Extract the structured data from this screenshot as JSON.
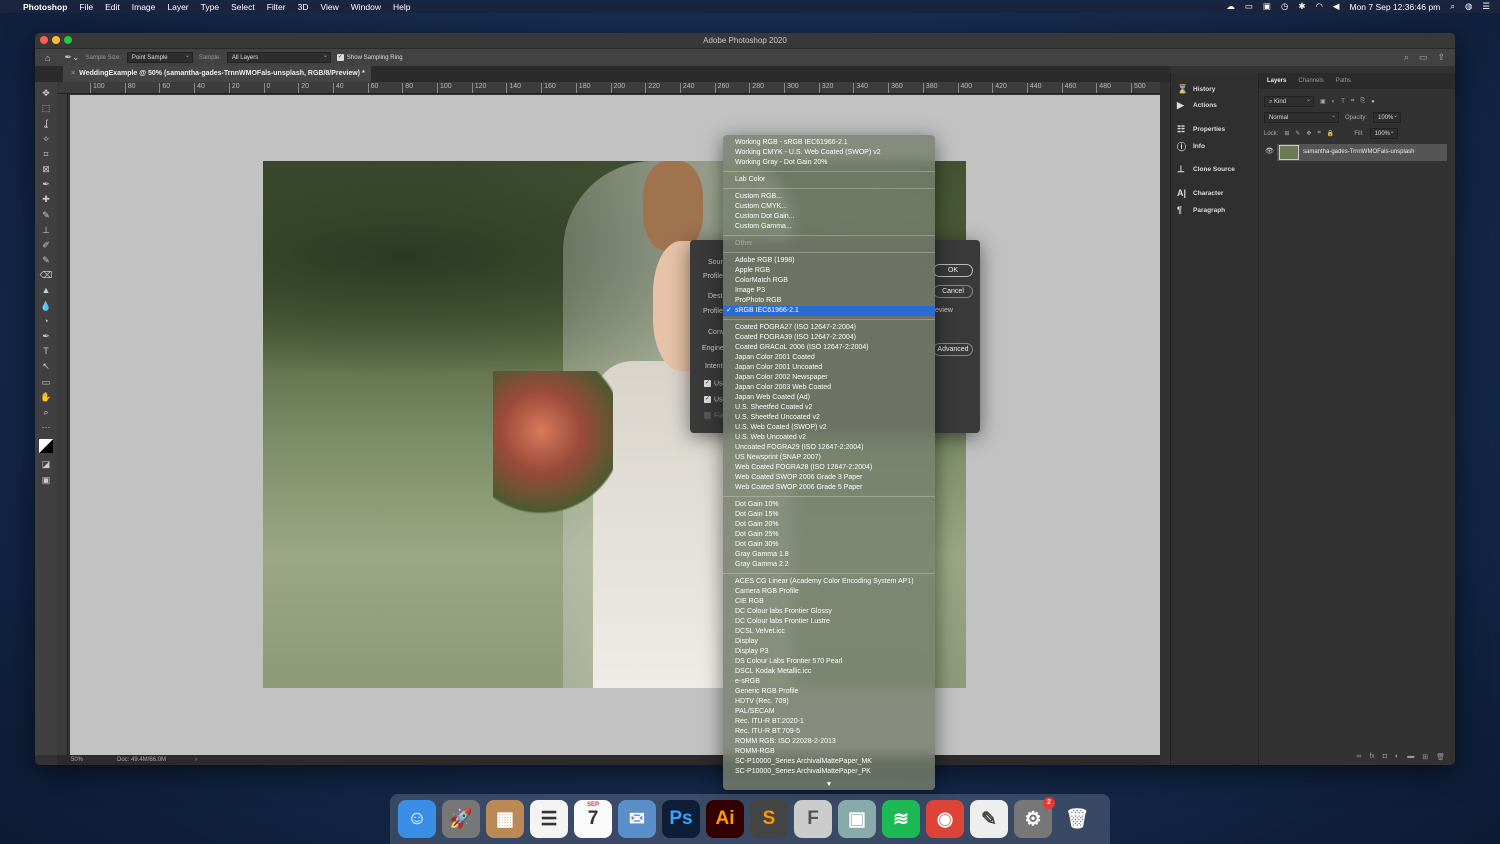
{
  "menubar": {
    "apple": "",
    "app": "Photoshop",
    "items": [
      "File",
      "Edit",
      "Image",
      "Layer",
      "Type",
      "Select",
      "Filter",
      "3D",
      "View",
      "Window",
      "Help"
    ],
    "clock": "Mon 7 Sep  12:36:46 pm"
  },
  "window": {
    "title": "Adobe Photoshop 2020"
  },
  "options": {
    "sample_size_label": "Sample Size:",
    "sample_size": "Point Sample",
    "sample_label": "Sample:",
    "sample": "All Layers",
    "show_ring": "Show Sampling Ring",
    "show_ring_checked": true
  },
  "document": {
    "tab": "WeddingExample @ 50% (samantha-gades-TrnnWMOFals-unsplash, RGB/8/Preview) *",
    "zoom": "50%",
    "doc_size": "Doc: 49.4M/66.0M"
  },
  "ruler": {
    "top": [
      "100",
      "80",
      "60",
      "40",
      "20",
      "0",
      "20",
      "40",
      "60",
      "80",
      "100",
      "120",
      "140",
      "160",
      "180",
      "200",
      "220",
      "240",
      "260",
      "280",
      "300",
      "320",
      "340",
      "360",
      "380",
      "400",
      "420",
      "440",
      "460",
      "480",
      "500"
    ]
  },
  "panels": {
    "collapsed": [
      {
        "icon": "history-icon",
        "label": "History"
      },
      {
        "icon": "actions-icon",
        "label": "Actions"
      },
      {
        "icon": "properties-icon",
        "label": "Properties"
      },
      {
        "icon": "info-icon",
        "label": "Info"
      },
      {
        "icon": "clone-source-icon",
        "label": "Clone Source"
      },
      {
        "icon": "character-icon",
        "label": "Character"
      },
      {
        "icon": "paragraph-icon",
        "label": "Paragraph"
      }
    ]
  },
  "layers": {
    "tabs": [
      "Layers",
      "Channels",
      "Paths"
    ],
    "filter": "Kind",
    "blend": "Normal",
    "opacity_label": "Opacity:",
    "opacity": "100%",
    "lock_label": "Lock:",
    "fill_label": "Fill:",
    "fill": "100%",
    "layer_name": "samantha-gades-TrnnWMOFals-unsplash"
  },
  "dialog": {
    "labels": [
      "Sour",
      "Profile",
      "Dest",
      "Profile",
      "Conv",
      "Engine",
      "Intent",
      "Use",
      "Use",
      "Flat"
    ],
    "ok": "OK",
    "cancel": "Cancel",
    "preview": "Preview",
    "advanced": "Advanced"
  },
  "dropdown": {
    "groups": [
      [
        "Working RGB - sRGB IEC61966-2.1",
        "Working CMYK - U.S. Web Coated (SWOP) v2",
        "Working Gray - Dot Gain 20%"
      ],
      [
        "Lab Color"
      ],
      [
        "Custom RGB...",
        "Custom CMYK...",
        "Custom Dot Gain...",
        "Custom Gamma..."
      ],
      [
        "Other"
      ],
      [
        "Adobe RGB (1998)",
        "Apple RGB",
        "ColorMatch RGB",
        "Image P3",
        "ProPhoto RGB",
        "sRGB IEC61966-2.1"
      ],
      [
        "Coated FOGRA27 (ISO 12647-2:2004)",
        "Coated FOGRA39 (ISO 12647-2:2004)",
        "Coated GRACoL 2006 (ISO 12647-2:2004)",
        "Japan Color 2001 Coated",
        "Japan Color 2001 Uncoated",
        "Japan Color 2002 Newspaper",
        "Japan Color 2003 Web Coated",
        "Japan Web Coated (Ad)",
        "U.S. Sheetfed Coated v2",
        "U.S. Sheetfed Uncoated v2",
        "U.S. Web Coated (SWOP) v2",
        "U.S. Web Uncoated v2",
        "Uncoated FOGRA29 (ISO 12647-2:2004)",
        "US Newsprint (SNAP 2007)",
        "Web Coated FOGRA28 (ISO 12647-2:2004)",
        "Web Coated SWOP 2006 Grade 3 Paper",
        "Web Coated SWOP 2006 Grade 5 Paper"
      ],
      [
        "Dot Gain 10%",
        "Dot Gain 15%",
        "Dot Gain 20%",
        "Dot Gain 25%",
        "Dot Gain 30%",
        "Gray Gamma 1.8",
        "Gray Gamma 2.2"
      ],
      [
        "ACES CG Linear (Academy Color Encoding System AP1)",
        "Camera RGB Profile",
        "CIE RGB",
        "DC Colour labs Frontier Glossy",
        "DC Colour labs Frontier Lustre",
        "DCSL Velvet.icc",
        "Display",
        "Display P3",
        "DS Colour Labs Frontier 570 Pearl",
        "DSCL Kodak Metallic.icc",
        "e-sRGB",
        "Generic RGB Profile",
        "HDTV (Rec. 709)",
        "PAL/SECAM",
        "Rec. ITU-R BT.2020-1",
        "Rec. ITU-R BT.709-5",
        "ROMM RGB: ISO 22028-2-2013",
        "ROMM-RGB",
        "SC-P10000_Series  ArchivalMattePaper_MK",
        "SC-P10000_Series  ArchivalMattePaper_PK"
      ]
    ],
    "selected": "sRGB IEC61966-2.1",
    "disabled": "Other",
    "accent": "#2c6ad8"
  },
  "dock": [
    {
      "name": "finder",
      "color": "#3a8ee6",
      "g": "☺"
    },
    {
      "name": "launchpad",
      "color": "#777",
      "g": "🚀"
    },
    {
      "name": "calculator",
      "color": "#b98a55",
      "g": "▦"
    },
    {
      "name": "reminders",
      "color": "#f4f4f4",
      "g": "☰"
    },
    {
      "name": "calendar",
      "color": "#fafafa",
      "g": "7",
      "sub": "SEP"
    },
    {
      "name": "mail",
      "color": "#5b8fc9",
      "g": "✉"
    },
    {
      "name": "photoshop",
      "color": "#0d1e36",
      "g": "Ps",
      "fg": "#31a8ff"
    },
    {
      "name": "illustrator",
      "color": "#330000",
      "g": "Ai",
      "fg": "#ff9a00"
    },
    {
      "name": "sublime-text",
      "color": "#444",
      "g": "S",
      "fg": "#ff9800"
    },
    {
      "name": "font-book",
      "color": "#ccc",
      "g": "F",
      "fg": "#555"
    },
    {
      "name": "preview",
      "color": "#8aa",
      "g": "▣"
    },
    {
      "name": "spotify",
      "color": "#1db954",
      "g": "≋"
    },
    {
      "name": "chrome",
      "color": "#db4437",
      "g": "◉"
    },
    {
      "name": "textedit",
      "color": "#eee",
      "g": "✎",
      "fg": "#444"
    },
    {
      "name": "system-preferences",
      "color": "#777",
      "g": "⚙",
      "badge": "2"
    },
    {
      "name": "trash",
      "color": "transparent",
      "g": "🗑"
    }
  ]
}
